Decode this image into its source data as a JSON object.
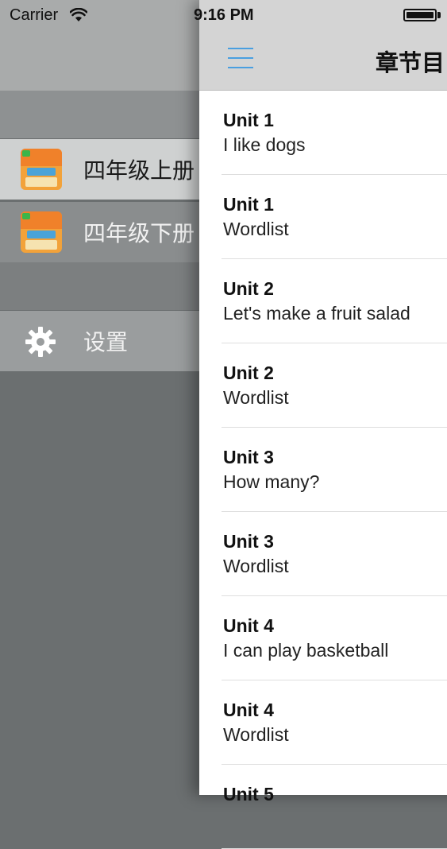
{
  "status_bar": {
    "carrier": "Carrier",
    "time": "9:16 PM"
  },
  "drawer": {
    "books": [
      {
        "label": "四年级上册",
        "icon": "textbook-cover-icon"
      },
      {
        "label": "四年级下册",
        "icon": "textbook-cover-icon"
      }
    ],
    "settings_label": "设置"
  },
  "nav": {
    "title": "章节目"
  },
  "chapters": [
    {
      "unit": "Unit 1",
      "title": "I like dogs"
    },
    {
      "unit": "Unit 1",
      "title": "Wordlist"
    },
    {
      "unit": "Unit 2",
      "title": "Let's make a fruit salad"
    },
    {
      "unit": "Unit 2",
      "title": "Wordlist"
    },
    {
      "unit": "Unit 3",
      "title": "How many?"
    },
    {
      "unit": "Unit 3",
      "title": "Wordlist"
    },
    {
      "unit": "Unit 4",
      "title": "I can play basketball"
    },
    {
      "unit": "Unit 4",
      "title": "Wordlist"
    },
    {
      "unit": "Unit 5",
      "title": ""
    }
  ],
  "colors": {
    "accent": "#4a9fe0",
    "drawer_bg": "#6b6f70"
  }
}
